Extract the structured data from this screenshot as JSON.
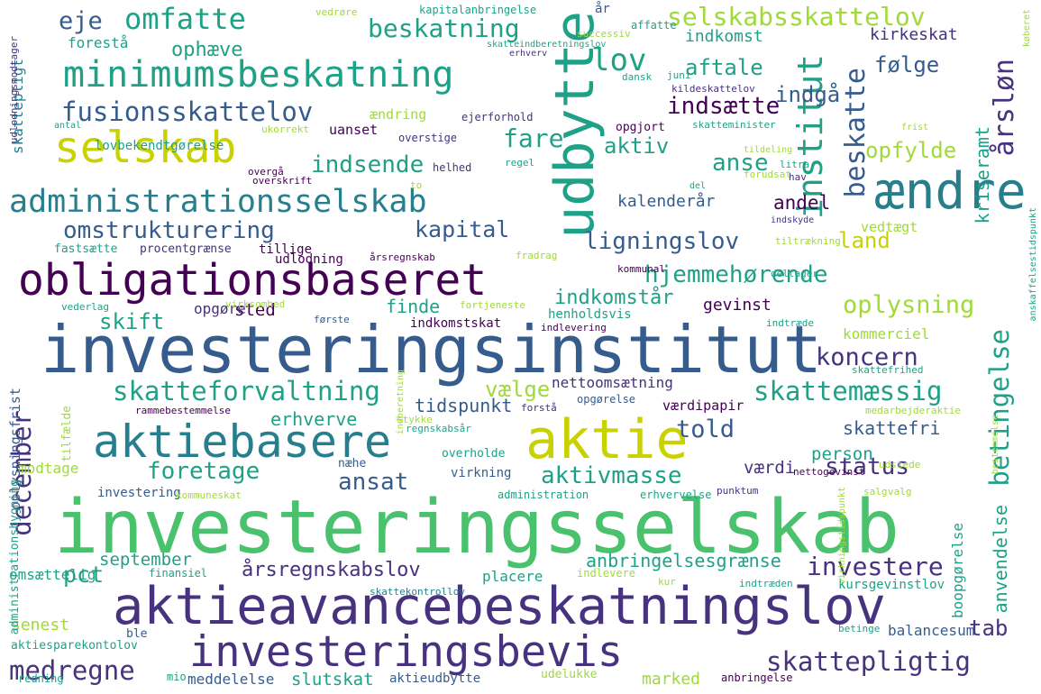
{
  "palette": {
    "purple": "#440154",
    "indigo": "#46327e",
    "blue": "#365c8d",
    "steel": "#277f8e",
    "teal": "#1fa187",
    "green": "#4ac16d",
    "lime": "#a0da39",
    "yellow": "#c8d200"
  },
  "words": [
    {
      "text": "investeringsselskab",
      "c": "green"
    },
    {
      "text": "investeringsinstitut",
      "c": "blue"
    },
    {
      "text": "aktieavancebeskatningslov",
      "c": "indigo"
    },
    {
      "text": "obligationsbaseret",
      "c": "purple"
    },
    {
      "text": "udbytte",
      "c": "teal"
    },
    {
      "text": "aktie",
      "c": "yellow"
    },
    {
      "text": "investeringsbevis",
      "c": "indigo"
    },
    {
      "text": "aktiebasere",
      "c": "steel"
    },
    {
      "text": "minimumsbeskatning",
      "c": "teal"
    },
    {
      "text": "ændre",
      "c": "steel"
    },
    {
      "text": "selskab",
      "c": "yellow"
    },
    {
      "text": "administrationsselskab",
      "c": "steel"
    },
    {
      "text": "selskabsskattelov",
      "c": "lime"
    },
    {
      "text": "omfatte",
      "c": "teal"
    },
    {
      "text": "fusionsskattelov",
      "c": "blue"
    },
    {
      "text": "beskatning",
      "c": "teal"
    },
    {
      "text": "lov",
      "c": "teal"
    },
    {
      "text": "eje",
      "c": "blue"
    },
    {
      "text": "institut",
      "c": "teal"
    },
    {
      "text": "skatteforvaltning",
      "c": "teal"
    },
    {
      "text": "skattemæssig",
      "c": "teal"
    },
    {
      "text": "hjemmehørende",
      "c": "teal"
    },
    {
      "text": "omstrukturering",
      "c": "blue"
    },
    {
      "text": "kapital",
      "c": "blue"
    },
    {
      "text": "ligningslov",
      "c": "blue"
    },
    {
      "text": "indsende",
      "c": "teal"
    },
    {
      "text": "indsætte",
      "c": "purple"
    },
    {
      "text": "beskatte",
      "c": "blue"
    },
    {
      "text": "betingelse",
      "c": "teal"
    },
    {
      "text": "december",
      "c": "indigo"
    },
    {
      "text": "foretage",
      "c": "teal"
    },
    {
      "text": "aktivmasse",
      "c": "teal"
    },
    {
      "text": "status",
      "c": "indigo"
    },
    {
      "text": "investere",
      "c": "indigo"
    },
    {
      "text": "skattepligtig",
      "c": "indigo"
    },
    {
      "text": "medregne",
      "c": "indigo"
    },
    {
      "text": "koncern",
      "c": "indigo"
    },
    {
      "text": "oplysning",
      "c": "lime"
    },
    {
      "text": "told",
      "c": "blue"
    },
    {
      "text": "land",
      "c": "yellow"
    },
    {
      "text": "fare",
      "c": "teal"
    },
    {
      "text": "anse",
      "c": "teal"
    },
    {
      "text": "aktiv",
      "c": "teal"
    },
    {
      "text": "årsløn",
      "c": "indigo"
    },
    {
      "text": "aftale",
      "c": "teal"
    },
    {
      "text": "indgå",
      "c": "blue"
    },
    {
      "text": "følge",
      "c": "blue"
    },
    {
      "text": "opfylde",
      "c": "lime"
    },
    {
      "text": "vælge",
      "c": "lime"
    },
    {
      "text": "ansat",
      "c": "blue"
    },
    {
      "text": "pct",
      "c": "teal"
    },
    {
      "text": "tab",
      "c": "indigo"
    },
    {
      "text": "skift",
      "c": "teal"
    },
    {
      "text": "ophæve",
      "c": "teal"
    },
    {
      "text": "årsregnskabslov",
      "c": "indigo"
    },
    {
      "text": "anbringelsesgrænse",
      "c": "teal"
    },
    {
      "text": "anvendelse",
      "c": "teal"
    },
    {
      "text": "indkomstår",
      "c": "teal"
    },
    {
      "text": "andel",
      "c": "purple"
    },
    {
      "text": "kalenderår",
      "c": "blue"
    },
    {
      "text": "gevinst",
      "c": "purple"
    },
    {
      "text": "finde",
      "c": "teal"
    },
    {
      "text": "sted",
      "c": "purple"
    },
    {
      "text": "erhverve",
      "c": "teal"
    },
    {
      "text": "tidspunkt",
      "c": "blue"
    },
    {
      "text": "nettoomsætning",
      "c": "indigo"
    },
    {
      "text": "værdipapir",
      "c": "purple"
    },
    {
      "text": "skattefri",
      "c": "blue"
    },
    {
      "text": "person",
      "c": "teal"
    },
    {
      "text": "værdi",
      "c": "indigo"
    },
    {
      "text": "september",
      "c": "teal"
    },
    {
      "text": "marked",
      "c": "lime"
    },
    {
      "text": "slutskat",
      "c": "teal"
    },
    {
      "text": "meddelelse",
      "c": "blue"
    },
    {
      "text": "senest",
      "c": "lime"
    },
    {
      "text": "balancesum",
      "c": "blue"
    },
    {
      "text": "kommerciel",
      "c": "lime"
    },
    {
      "text": "kriseramt",
      "c": "teal"
    },
    {
      "text": "kirkeskat",
      "c": "indigo"
    },
    {
      "text": "indkomst",
      "c": "teal"
    },
    {
      "text": "forestå",
      "c": "teal"
    },
    {
      "text": "skattepligt",
      "c": "steel"
    },
    {
      "text": "ændring",
      "c": "lime"
    },
    {
      "text": "uanset",
      "c": "purple"
    },
    {
      "text": "vedtægt",
      "c": "lime"
    },
    {
      "text": "boopgørelse",
      "c": "teal"
    },
    {
      "text": "kursgevinstlov",
      "c": "teal"
    },
    {
      "text": "aktieudbytte",
      "c": "blue"
    },
    {
      "text": "modtage",
      "c": "lime"
    },
    {
      "text": "investering",
      "c": "blue"
    },
    {
      "text": "opgøre",
      "c": "indigo"
    },
    {
      "text": "placere",
      "c": "teal"
    },
    {
      "text": "lovbekendtgørelse",
      "c": "teal"
    },
    {
      "text": "tillige",
      "c": "purple"
    },
    {
      "text": "udlodning",
      "c": "purple"
    },
    {
      "text": "indkomstskat",
      "c": "purple"
    },
    {
      "text": "henholdsvis",
      "c": "teal"
    },
    {
      "text": "ejerforhold",
      "c": "indigo"
    },
    {
      "text": "overstige",
      "c": "indigo"
    },
    {
      "text": "opgjort",
      "c": "purple"
    },
    {
      "text": "skatteminister",
      "c": "teal"
    },
    {
      "text": "helhed",
      "c": "indigo"
    },
    {
      "text": "regel",
      "c": "teal"
    },
    {
      "text": "overgå",
      "c": "purple"
    },
    {
      "text": "overskrift",
      "c": "purple"
    },
    {
      "text": "fastsætte",
      "c": "teal"
    },
    {
      "text": "procentgrænse",
      "c": "indigo"
    },
    {
      "text": "årsregnskab",
      "c": "purple"
    },
    {
      "text": "fradrag",
      "c": "lime"
    },
    {
      "text": "kommunal",
      "c": "purple"
    },
    {
      "text": "deltager",
      "c": "teal"
    },
    {
      "text": "tiltrækning",
      "c": "lime"
    },
    {
      "text": "virksomhed",
      "c": "lime"
    },
    {
      "text": "fortjeneste",
      "c": "lime"
    },
    {
      "text": "indlevering",
      "c": "purple"
    },
    {
      "text": "første",
      "c": "blue"
    },
    {
      "text": "vederlag",
      "c": "teal"
    },
    {
      "text": "indtræde",
      "c": "teal"
    },
    {
      "text": "skattefrihed",
      "c": "teal"
    },
    {
      "text": "medarbejderaktie",
      "c": "lime"
    },
    {
      "text": "opgørelse",
      "c": "blue"
    },
    {
      "text": "forstå",
      "c": "indigo"
    },
    {
      "text": "stykke",
      "c": "lime"
    },
    {
      "text": "rammebestemmelse",
      "c": "purple"
    },
    {
      "text": "regnskabsår",
      "c": "teal"
    },
    {
      "text": "overholde",
      "c": "teal"
    },
    {
      "text": "virkning",
      "c": "blue"
    },
    {
      "text": "næhe",
      "c": "blue"
    },
    {
      "text": "administration",
      "c": "teal"
    },
    {
      "text": "erhvervelse",
      "c": "teal"
    },
    {
      "text": "kommuneskat",
      "c": "lime"
    },
    {
      "text": "nettogevinst",
      "c": "purple"
    },
    {
      "text": "udstede",
      "c": "lime"
    },
    {
      "text": "punktum",
      "c": "indigo"
    },
    {
      "text": "salg",
      "c": "lime"
    },
    {
      "text": "valg",
      "c": "lime"
    },
    {
      "text": "finansiel",
      "c": "teal"
    },
    {
      "text": "indlevere",
      "c": "lime"
    },
    {
      "text": "kur",
      "c": "lime"
    },
    {
      "text": "indtræden",
      "c": "teal"
    },
    {
      "text": "skattekontrollov",
      "c": "steel"
    },
    {
      "text": "ble",
      "c": "blue"
    },
    {
      "text": "betinge",
      "c": "teal"
    },
    {
      "text": "aktiesparekontolov",
      "c": "teal"
    },
    {
      "text": "udelukke",
      "c": "lime"
    },
    {
      "text": "anbringelse",
      "c": "purple"
    },
    {
      "text": "redning",
      "c": "teal"
    },
    {
      "text": "mio",
      "c": "teal"
    },
    {
      "text": "omsættelig",
      "c": "teal"
    },
    {
      "text": "tilfælde",
      "c": "lime"
    },
    {
      "text": "oplysningsfrist",
      "c": "blue"
    },
    {
      "text": "administrationsbygning",
      "c": "teal"
    },
    {
      "text": "udlodningsmodtager",
      "c": "indigo"
    },
    {
      "text": "kapitalanbringelse",
      "c": "teal"
    },
    {
      "text": "vedrøre",
      "c": "lime"
    },
    {
      "text": "affatte",
      "c": "teal"
    },
    {
      "text": "år",
      "c": "blue"
    },
    {
      "text": "successiv",
      "c": "lime"
    },
    {
      "text": "skatteindberetningslov",
      "c": "teal"
    },
    {
      "text": "erhverv",
      "c": "indigo"
    },
    {
      "text": "juni",
      "c": "teal"
    },
    {
      "text": "dansk",
      "c": "teal"
    },
    {
      "text": "kildeskattelov",
      "c": "indigo"
    },
    {
      "text": "antal",
      "c": "teal"
    },
    {
      "text": "ukorrekt",
      "c": "lime"
    },
    {
      "text": "frist",
      "c": "lime"
    },
    {
      "text": "tildeling",
      "c": "lime"
    },
    {
      "text": "forudsat",
      "c": "lime"
    },
    {
      "text": "litra",
      "c": "teal"
    },
    {
      "text": "hav",
      "c": "indigo"
    },
    {
      "text": "to",
      "c": "lime"
    },
    {
      "text": "del",
      "c": "teal"
    },
    {
      "text": "indskyde",
      "c": "indigo"
    },
    {
      "text": "køberet",
      "c": "lime"
    },
    {
      "text": "anskaffelsestidspunkt",
      "c": "teal"
    },
    {
      "text": "bestemmelse",
      "c": "lime"
    },
    {
      "text": "virkningstidspunkt",
      "c": "lime"
    },
    {
      "text": "indberetning",
      "c": "lime"
    }
  ]
}
